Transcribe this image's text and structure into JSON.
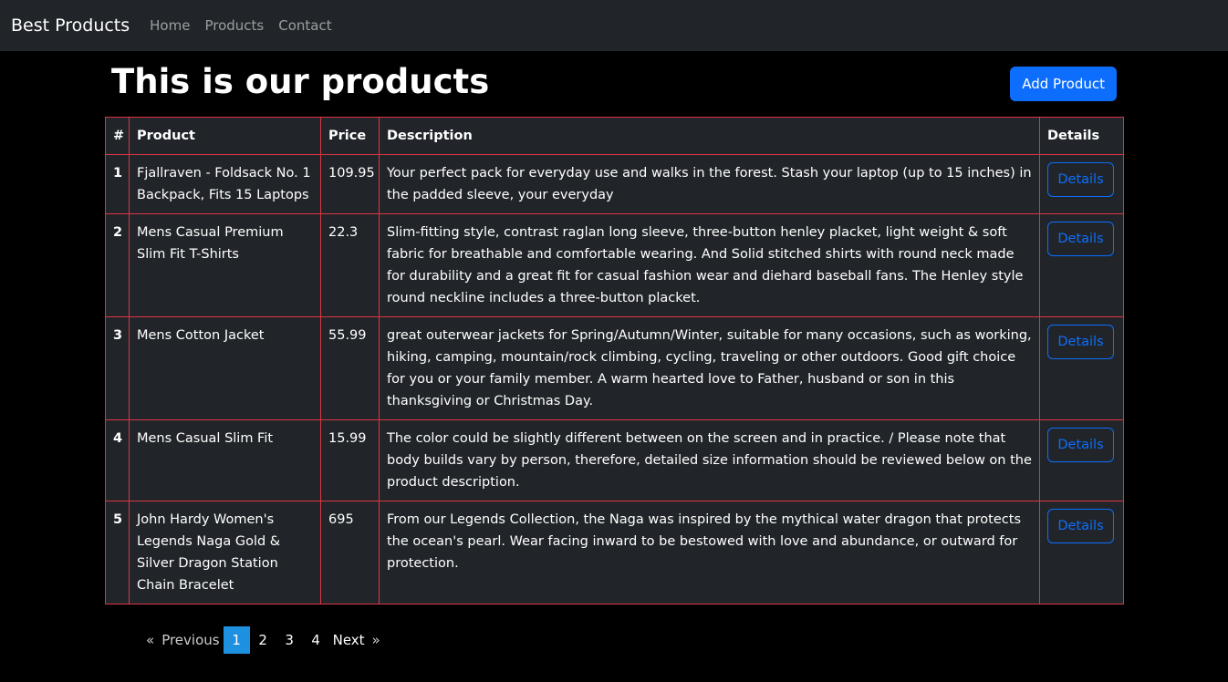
{
  "nav": {
    "brand": "Best Products",
    "links": [
      "Home",
      "Products",
      "Contact"
    ]
  },
  "header": {
    "title": "This is our products",
    "add_button": "Add Product"
  },
  "table": {
    "columns": [
      "#",
      "Product",
      "Price",
      "Description",
      "Details"
    ],
    "rows": [
      {
        "num": "1",
        "product": "Fjallraven - Foldsack No. 1 Backpack, Fits 15 Laptops",
        "price": "109.95",
        "description": "Your perfect pack for everyday use and walks in the forest. Stash your laptop (up to 15 inches) in the padded sleeve, your everyday",
        "details": "Details"
      },
      {
        "num": "2",
        "product": "Mens Casual Premium Slim Fit T-Shirts",
        "price": "22.3",
        "description": "Slim-fitting style, contrast raglan long sleeve, three-button henley placket, light weight & soft fabric for breathable and comfortable wearing. And Solid stitched shirts with round neck made for durability and a great fit for casual fashion wear and diehard baseball fans. The Henley style round neckline includes a three-button placket.",
        "details": "Details"
      },
      {
        "num": "3",
        "product": "Mens Cotton Jacket",
        "price": "55.99",
        "description": "great outerwear jackets for Spring/Autumn/Winter, suitable for many occasions, such as working, hiking, camping, mountain/rock climbing, cycling, traveling or other outdoors. Good gift choice for you or your family member. A warm hearted love to Father, husband or son in this thanksgiving or Christmas Day.",
        "details": "Details"
      },
      {
        "num": "4",
        "product": "Mens Casual Slim Fit",
        "price": "15.99",
        "description": "The color could be slightly different between on the screen and in practice. / Please note that body builds vary by person, therefore, detailed size information should be reviewed below on the product description.",
        "details": "Details"
      },
      {
        "num": "5",
        "product": "John Hardy Women's Legends Naga Gold & Silver Dragon Station Chain Bracelet",
        "price": "695",
        "description": "From our Legends Collection, the Naga was inspired by the mythical water dragon that protects the ocean's pearl. Wear facing inward to be bestowed with love and abundance, or outward for protection.",
        "details": "Details"
      }
    ]
  },
  "pagination": {
    "prev_arrow": "«",
    "prev_label": "Previous",
    "pages": [
      "1",
      "2",
      "3",
      "4"
    ],
    "current": "1",
    "next_label": "Next",
    "next_arrow": "»"
  },
  "colors": {
    "navbar_bg": "#212529",
    "page_bg": "#000000",
    "primary": "#0d6efd",
    "table_border": "#dc3545",
    "active_page": "#1e90e0"
  }
}
